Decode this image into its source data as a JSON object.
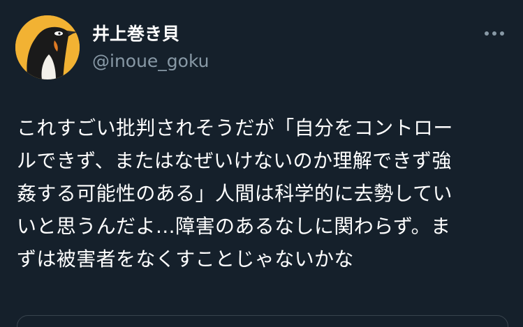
{
  "tweet": {
    "author": {
      "display_name": "井上巻き貝",
      "handle": "@inoue_goku",
      "avatar_icon": "penguin-avatar-icon"
    },
    "more_icon": "more-options-icon",
    "text_lines": [
      "これすごい批判されそうだが「自分をコントロー",
      "ルできず、またはなぜいけないのか理解できず強",
      "姦する可能性のある」人間は科学的に去勢してい",
      "いと思うんだよ…障害のあるなしに関わらず。ま",
      "ずは被害者をなくすことじゃないかな"
    ],
    "colors": {
      "background": "#15202b",
      "text": "#ffffff",
      "secondary_text": "#8899a6",
      "border": "#38444d",
      "avatar_background": "#f2b233"
    }
  }
}
